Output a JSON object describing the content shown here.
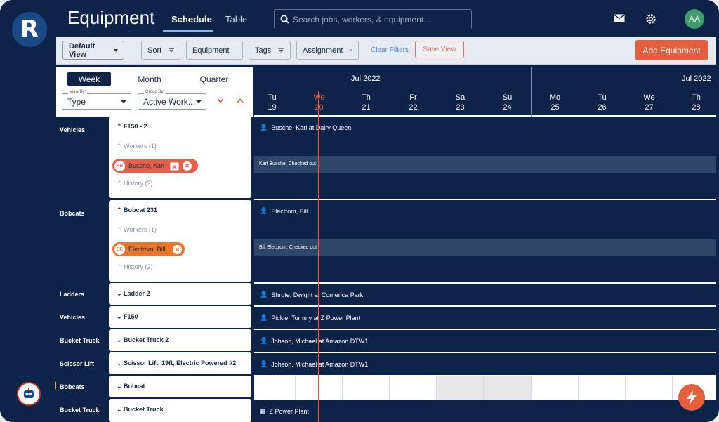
{
  "app": {
    "logo": "R",
    "title": "Equipment",
    "avatar": "AA",
    "accent": "#e45f3e",
    "navy": "#0d2347"
  },
  "tabs": [
    {
      "label": "Schedule",
      "active": true
    },
    {
      "label": "Table",
      "active": false
    }
  ],
  "search": {
    "placeholder": "Search jobs, workers, & equipment..."
  },
  "icons": {
    "mail": "mail-icon",
    "settings": "gear-icon",
    "robot": "robot-avatar-icon",
    "fab": "lightning-icon"
  },
  "toolbar": {
    "default_view": "Default View",
    "sort": "Sort",
    "equipment": "Equipment",
    "tags": "Tags",
    "assignment": "Assignment",
    "clear": "Clear Filters",
    "save": "Save View",
    "add": "Add Equipment"
  },
  "views": {
    "week": "Week",
    "month": "Month",
    "quarter": "Quarter",
    "active": "Week"
  },
  "view_by": {
    "label": "View By:",
    "value": "Type"
  },
  "group_by": {
    "label": "Group By:",
    "value": "Active Work..."
  },
  "calendar": {
    "months": [
      "Jul 2022",
      "Jul 2022"
    ],
    "days": [
      {
        "dow": "Tu",
        "date": "19"
      },
      {
        "dow": "We",
        "date": "20",
        "today": true
      },
      {
        "dow": "Th",
        "date": "21"
      },
      {
        "dow": "Fr",
        "date": "22"
      },
      {
        "dow": "Sa",
        "date": "23"
      },
      {
        "dow": "Su",
        "date": "24"
      },
      {
        "dow": "Mo",
        "date": "25"
      },
      {
        "dow": "Tu",
        "date": "26"
      },
      {
        "dow": "We",
        "date": "27"
      },
      {
        "dow": "Th",
        "date": "28"
      }
    ]
  },
  "rows": [
    {
      "type": "Vehicles",
      "name": "F150 - 2",
      "workers": "Workers (1)",
      "history": "History (2)",
      "chip_initials": "KB",
      "chip_name": "Busche, Karl",
      "event": "Busche, Karl at Dairy Queen",
      "band": "Karl Busche, Checked out"
    },
    {
      "type": "Bobcats",
      "name": "Bobcat 231",
      "workers": "Workers (1)",
      "history": "History (2)",
      "chip_initials": "BE",
      "chip_name": "Electrom, Bill",
      "event": "Electrom, Bill",
      "band": "Bill Electrom, Checked out"
    },
    {
      "type": "Ladders",
      "name": "Ladder 2",
      "event": "Shrute, Dwight at Comerica Park"
    },
    {
      "type": "Vehicles",
      "name": "F150",
      "event": "Pickle, Tommy at Z Power Plant"
    },
    {
      "type": "Bucket Truck",
      "name": "Bucket Truck 2",
      "event": "Johson, Michael at Amazon DTW1"
    },
    {
      "type": "Scissor Lift",
      "name": "Scissor Lift, 19ft, Electric Powered #2",
      "event": "Johson, Michael at Amazon DTW1"
    },
    {
      "type": "Bobcats",
      "name": "Bobcat"
    },
    {
      "type": "Bucket Truck",
      "name": "Bucket Truck",
      "event": "Z Power Plant"
    }
  ]
}
